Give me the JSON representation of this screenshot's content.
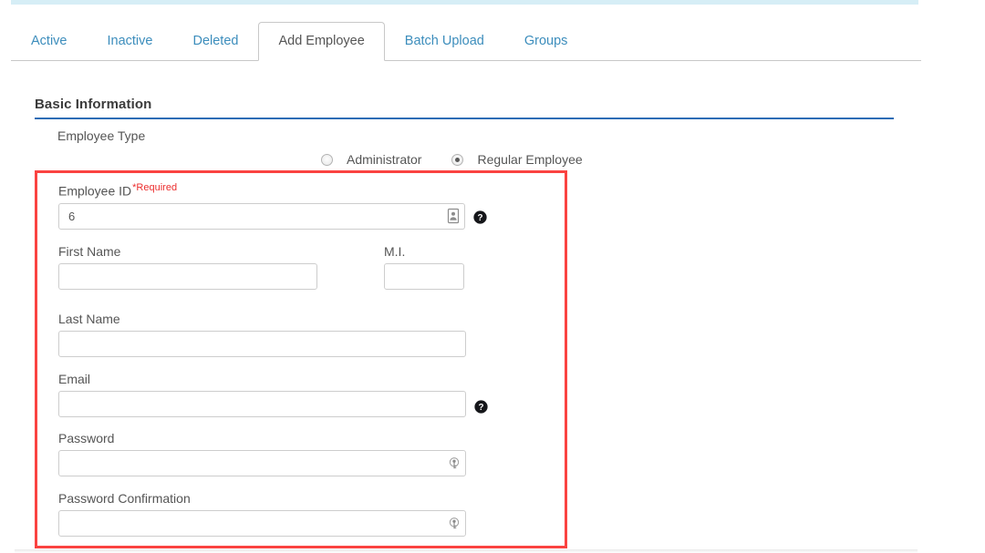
{
  "window": {
    "title": "Add Employee"
  },
  "accent": {
    "top_bar_color": "#d6eef6",
    "tab_link_color": "#3c8dbc",
    "section_rule_color": "#2d6cb5",
    "highlight_border_color": "#fa4341",
    "required_color": "#ec2e2e"
  },
  "tabs": [
    {
      "label": "Active",
      "active": false
    },
    {
      "label": "Inactive",
      "active": false
    },
    {
      "label": "Deleted",
      "active": false
    },
    {
      "label": "Add Employee",
      "active": true
    },
    {
      "label": "Batch Upload",
      "active": false
    },
    {
      "label": "Groups",
      "active": false
    }
  ],
  "section": {
    "title": "Basic Information"
  },
  "employee_type": {
    "label": "Employee Type",
    "options": [
      {
        "label": "Administrator",
        "selected": false
      },
      {
        "label": "Regular Employee",
        "selected": true
      }
    ]
  },
  "form": {
    "employee_id": {
      "label": "Employee ID",
      "required_text": "*Required",
      "value": "6",
      "placeholder": "",
      "field_icon": "id-card-icon",
      "help_icon": "help-circle-icon"
    },
    "first_name": {
      "label": "First Name",
      "value": "",
      "placeholder": ""
    },
    "middle_initial": {
      "label": "M.I.",
      "value": "",
      "placeholder": ""
    },
    "last_name": {
      "label": "Last Name",
      "value": "",
      "placeholder": ""
    },
    "email": {
      "label": "Email",
      "value": "",
      "placeholder": "",
      "help_icon": "help-circle-icon"
    },
    "password": {
      "label": "Password",
      "value": "",
      "placeholder": "",
      "field_icon": "key-circle-icon"
    },
    "password_confirmation": {
      "label": "Password Confirmation",
      "value": "",
      "placeholder": "",
      "field_icon": "key-circle-icon"
    }
  }
}
